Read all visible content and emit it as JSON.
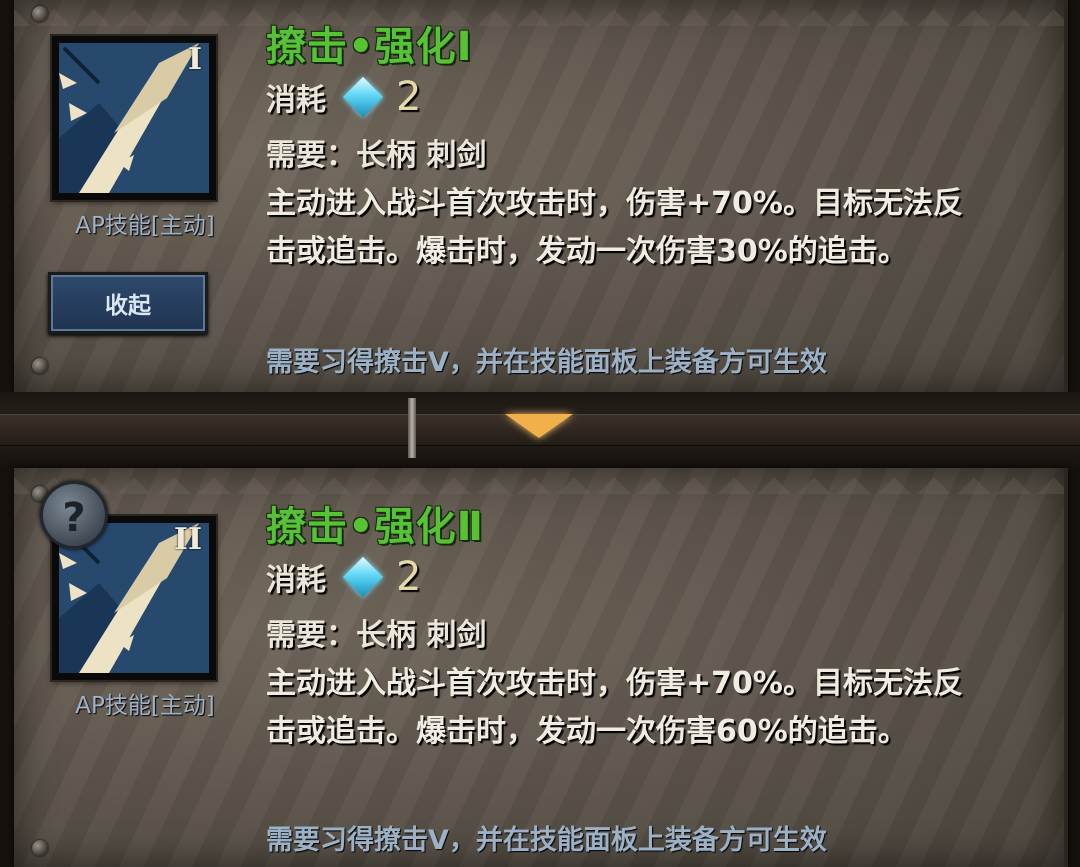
{
  "skills": [
    {
      "title": "撩击•强化Ⅰ",
      "icon_roman": "I",
      "icon_name": "spear-thrust-icon",
      "type_label": "AP技能[主动]",
      "cost_label": "消耗",
      "cost_value": "2",
      "requirement": "需要：长柄  刺剑",
      "description": "主动进入战斗首次攻击时，伤害+70%。目标无法反击或追击。爆击时，发动一次伤害30%的追击。",
      "note": "需要习得撩击Ⅴ，并在技能面板上装备方可生效",
      "button_label": "收起"
    },
    {
      "title": "撩击•强化Ⅱ",
      "icon_roman": "II",
      "icon_name": "spear-thrust-icon",
      "type_label": "AP技能[主动]",
      "cost_label": "消耗",
      "cost_value": "2",
      "requirement": "需要：长柄  刺剑",
      "description": "主动进入战斗首次攻击时，伤害+70%。目标无法反击或追击。爆击时，发动一次伤害60%的追击。",
      "note": "需要习得撩击Ⅴ，并在技能面板上装备方可生效",
      "help_glyph": "?"
    }
  ],
  "colors": {
    "title_green": "#57c234",
    "note_blue": "#9cb0c6",
    "gem_cyan": "#5fd8f5",
    "arrow_gold": "#f2b04a"
  }
}
